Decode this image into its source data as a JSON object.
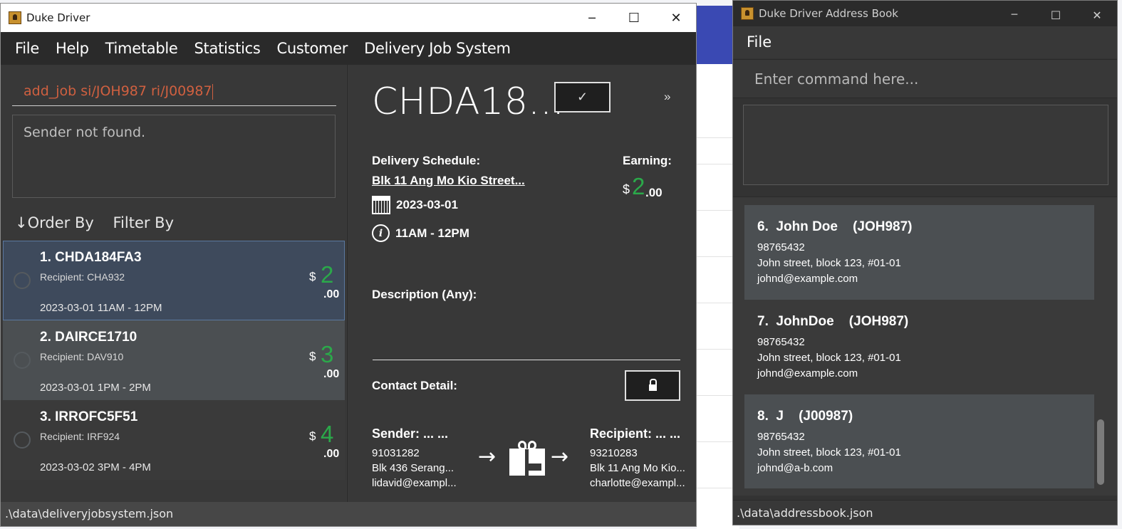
{
  "main_window": {
    "title": "Duke Driver",
    "controls": {
      "minimize": "─",
      "maximize": "☐",
      "close": "✕"
    },
    "menu": [
      "File",
      "Help",
      "Timetable",
      "Statistics",
      "Customer",
      "Delivery Job System"
    ],
    "command_value": "add_job si/JOH987 ri/J00987",
    "result_text": "Sender not found.",
    "order_by": "↓Order By",
    "filter_by": "Filter By",
    "jobs": [
      {
        "title": "1.  CHDA184FA3",
        "recipient": "Recipient: CHA932",
        "datetime": "2023-03-01 11AM - 12PM",
        "dollar": "$",
        "amount": "2",
        "cents": ".00"
      },
      {
        "title": "2.  DAIRCE1710",
        "recipient": "Recipient: DAV910",
        "datetime": "2023-03-01 1PM  - 2PM",
        "dollar": "$",
        "amount": "3",
        "cents": ".00"
      },
      {
        "title": "3.  IRROFC5F51",
        "recipient": "Recipient: IRF924",
        "datetime": "2023-03-02 3PM  - 4PM",
        "dollar": "$",
        "amount": "4",
        "cents": ".00"
      }
    ],
    "detail": {
      "job_id": "CHDA18...",
      "check_icon": "✓",
      "next_icon": "»",
      "delivery_schedule_label": "Delivery Schedule:",
      "address": "Blk 11 Ang Mo Kio Street...",
      "date": "2023-03-01",
      "time": "11AM - 12PM",
      "earning_label": "Earning:",
      "earning_dollar": "$",
      "earning_amount": "2",
      "earning_cents": ".00",
      "description_label": "Description (Any):",
      "contact_label": "Contact Detail:",
      "sender": {
        "header": "Sender:  ...   ...",
        "phone": "91031282",
        "address": "Blk 436 Serang...",
        "email": "lidavid@exampl..."
      },
      "recipient": {
        "header": "Recipient:  ...   ...",
        "phone": "93210283",
        "address": "Blk 11 Ang Mo Kio...",
        "email": "charlotte@exampl..."
      },
      "arrow": "→"
    },
    "status_path": ".\\data\\deliveryjobsystem.json"
  },
  "address_book": {
    "title": "Duke Driver Address Book",
    "controls": {
      "minimize": "─",
      "maximize": "☐",
      "close": "✕"
    },
    "menu": [
      "File"
    ],
    "command_placeholder": "Enter command here...",
    "persons": [
      {
        "name": "6.  John Doe    (JOH987)",
        "phone": "98765432",
        "address": "John street, block 123, #01-01",
        "email": "johnd@example.com"
      },
      {
        "name": "7.  JohnDoe    (JOH987)",
        "phone": "98765432",
        "address": "John street, block 123, #01-01",
        "email": "johnd@example.com"
      },
      {
        "name": "8.  J    (J00987)",
        "phone": "98765432",
        "address": "John street, block 123, #01-01",
        "email": "johnd@a-b.com"
      }
    ],
    "status_path": ".\\data\\addressbook.json"
  },
  "colors": {
    "accent_green": "#2ba94a",
    "command_text": "#d06040",
    "selected_row": "#3e4a5c"
  }
}
